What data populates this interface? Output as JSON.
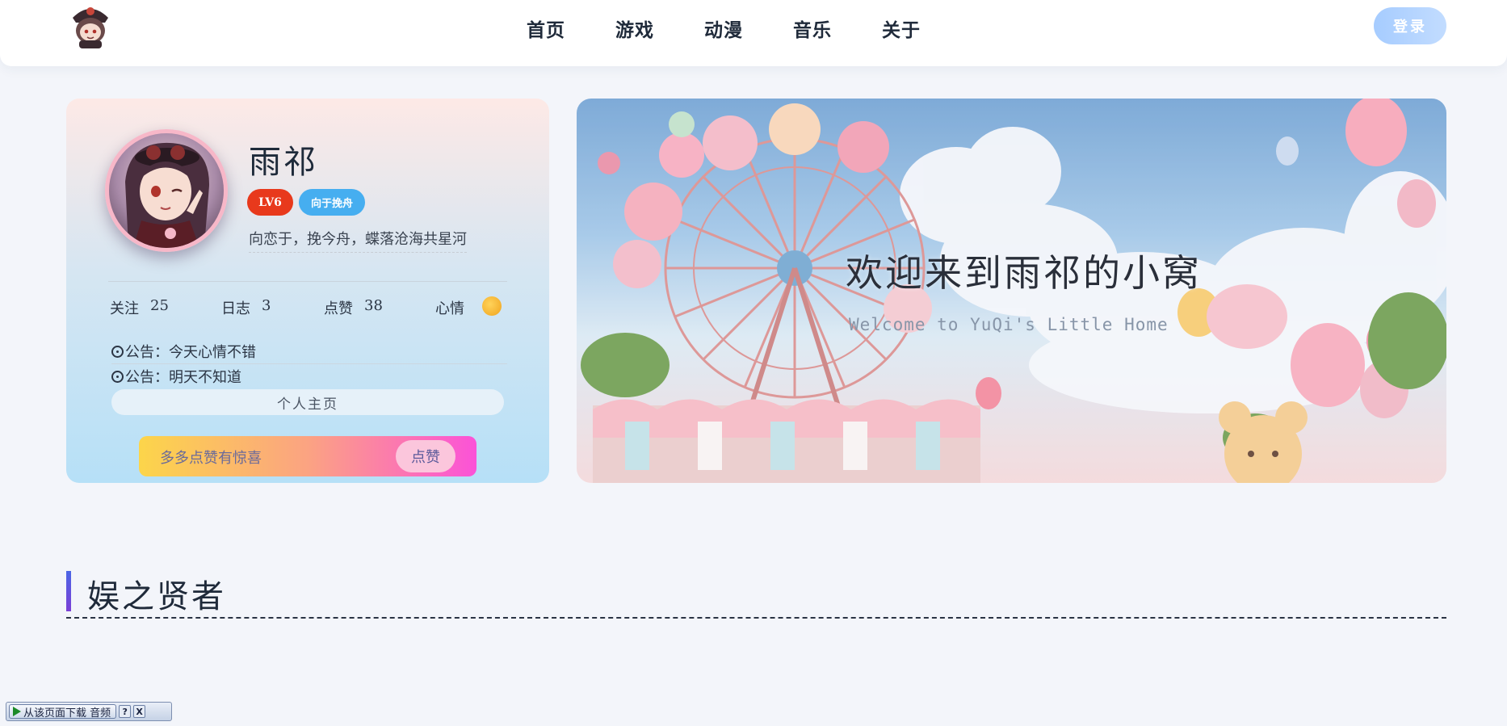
{
  "header": {
    "logo_icon": "chibi-character-logo-icon",
    "nav": [
      "首页",
      "游戏",
      "动漫",
      "音乐",
      "关于"
    ],
    "login_label": "登录"
  },
  "profile": {
    "avatar_icon": "anime-avatar-icon",
    "name": "雨祁",
    "level_badge": "LV6",
    "tag_badge": "向于挽舟",
    "motto": "向恋于，挽今舟，蝶落沧海共星河",
    "stats": [
      {
        "label": "关注",
        "value": "25"
      },
      {
        "label": "日志",
        "value": "3"
      },
      {
        "label": "点赞",
        "value": "38"
      },
      {
        "label": "心情",
        "icon": "smiley-emoji-icon"
      }
    ],
    "notices": [
      "公告：今天心情不错",
      "公告：明天不知道"
    ],
    "homepage_label": "个人主页",
    "like_prompt": "多多点赞有惊喜",
    "like_button": "点赞"
  },
  "banner": {
    "title": "欢迎来到雨祁的小窝",
    "subtitle": "Welcome to YuQi's Little Home",
    "image": "anime-ferris-wheel-balloons-illustration"
  },
  "section": {
    "title": "娱之贤者"
  },
  "download_toolbar": {
    "label": "从该页面下载 音频",
    "help": "?",
    "close": "X"
  },
  "colors": {
    "level_badge": "#e8391c",
    "tag_badge": "#46aef0",
    "login_button": "#a6ccff",
    "section_accent": "#4b66e6"
  }
}
